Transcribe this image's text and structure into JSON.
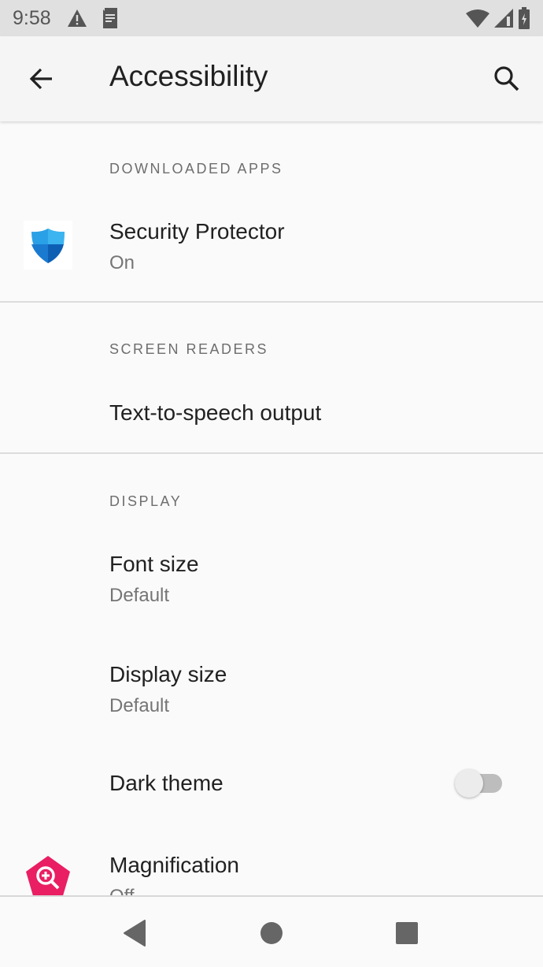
{
  "status_bar": {
    "time": "9:58",
    "icons_left": [
      "warning-icon",
      "notification-doc-icon"
    ],
    "icons_right": [
      "wifi-icon",
      "signal-icon",
      "battery-charging-icon"
    ]
  },
  "app_bar": {
    "title": "Accessibility",
    "back_icon": "arrow-back-icon",
    "search_icon": "search-icon"
  },
  "sections": [
    {
      "header": "DOWNLOADED APPS",
      "items": [
        {
          "title": "Security Protector",
          "subtitle": "On",
          "icon": "shield-icon"
        }
      ]
    },
    {
      "header": "SCREEN READERS",
      "items": [
        {
          "title": "Text-to-speech output"
        }
      ]
    },
    {
      "header": "DISPLAY",
      "items": [
        {
          "title": "Font size",
          "subtitle": "Default"
        },
        {
          "title": "Display size",
          "subtitle": "Default"
        },
        {
          "title": "Dark theme",
          "toggle": false
        },
        {
          "title": "Magnification",
          "subtitle": "Off",
          "icon": "magnification-icon"
        }
      ]
    }
  ],
  "nav_bar": {
    "buttons": [
      "back-triangle-icon",
      "home-circle-icon",
      "recents-square-icon"
    ]
  },
  "colors": {
    "shield_light": "#2aa0e6",
    "shield_dark": "#0d5fb4",
    "magnification": "#e91e63"
  }
}
